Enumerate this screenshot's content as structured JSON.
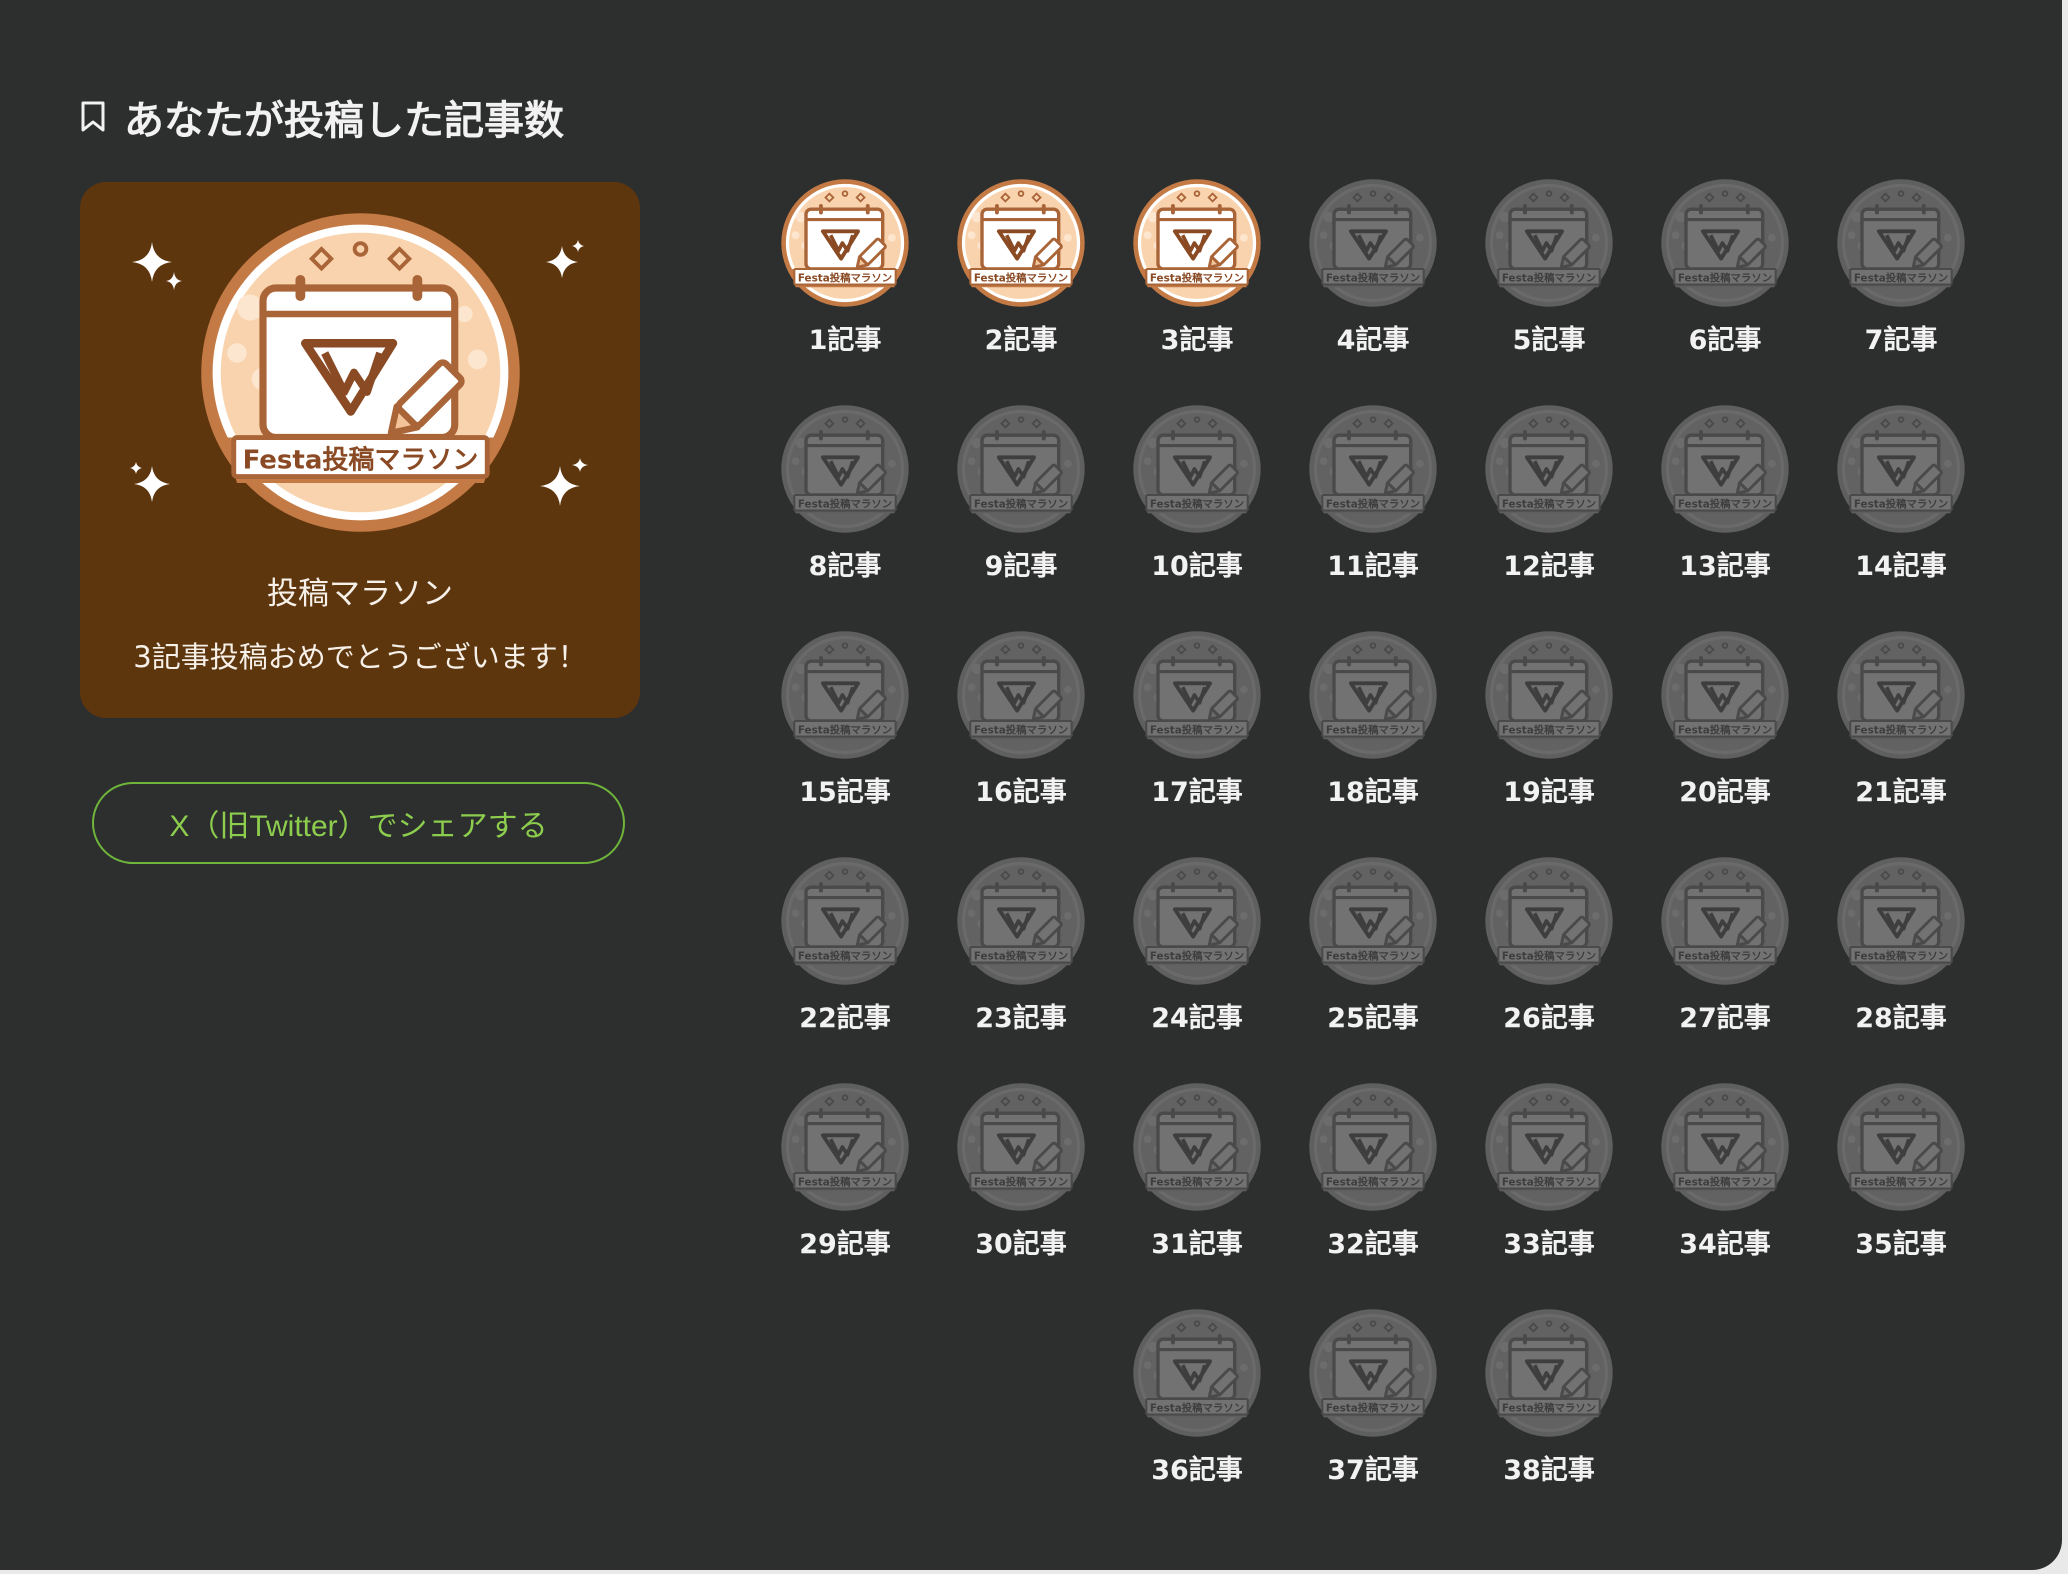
{
  "section": {
    "title": "あなたが投稿した記事数",
    "icon": "bookmark-icon"
  },
  "feature": {
    "badge_text": "Festa投稿マラソン",
    "name": "投稿マラソン",
    "message": "3記事投稿おめでとうございます！",
    "background": "#5e360e"
  },
  "share": {
    "label": "X（旧Twitter）でシェアする",
    "color": "#8ccd4e"
  },
  "badges": {
    "earned_count": 3,
    "badge_text": "Festa投稿マラソン",
    "items": [
      "1記事",
      "2記事",
      "3記事",
      "4記事",
      "5記事",
      "6記事",
      "7記事",
      "8記事",
      "9記事",
      "10記事",
      "11記事",
      "12記事",
      "13記事",
      "14記事",
      "15記事",
      "16記事",
      "17記事",
      "18記事",
      "19記事",
      "20記事",
      "21記事",
      "22記事",
      "23記事",
      "24記事",
      "25記事",
      "26記事",
      "27記事",
      "28記事",
      "29記事",
      "30記事",
      "31記事",
      "32記事",
      "33記事",
      "34記事",
      "35記事",
      "36記事",
      "37記事",
      "38記事"
    ]
  }
}
